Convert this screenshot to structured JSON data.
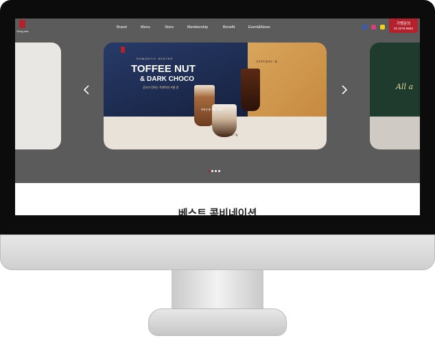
{
  "nav": {
    "logo_text": "Gong cha",
    "menu": [
      "Brand",
      "Menu",
      "Store",
      "Membership",
      "Benefit",
      "Event&News"
    ],
    "social_icons": [
      "facebook-icon",
      "instagram-icon",
      "kakaotalk-icon"
    ],
    "franchise": {
      "title": "가맹문의",
      "phone": "02 3276-9583"
    }
  },
  "hero": {
    "kicker": "ROMANTIC WINTER",
    "title_line1": "TOFFEE NUT",
    "title_line2": "& DARK CHOCO",
    "subtitle": "공차가 전하는 로맨틱한 겨울 맛",
    "product_labels": [
      "토피넛 폼 크림 스무디",
      "토피넛 밀크티 + 펄",
      "다크초코 밀크티 + 펄"
    ],
    "right_slide_text": "All a",
    "dots_count": 4,
    "active_dot": 1
  },
  "section": {
    "heading": "베스트 콤비네이션"
  },
  "colors": {
    "brand_red": "#b5202d",
    "nav_bg": "#5b5b5b"
  }
}
